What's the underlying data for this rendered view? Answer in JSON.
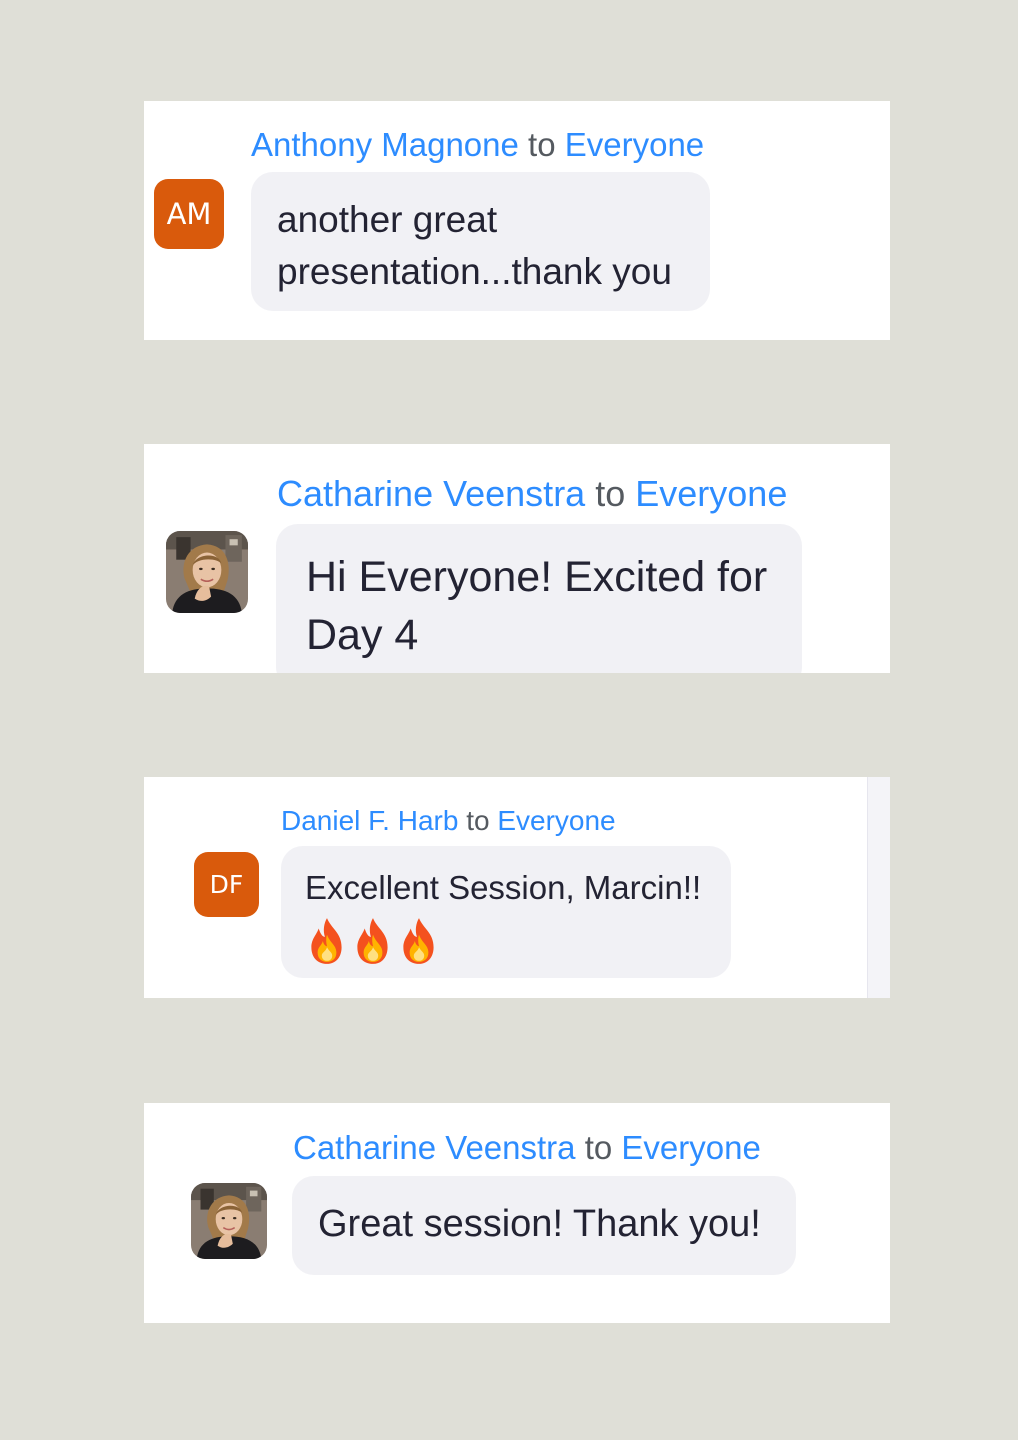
{
  "messages": [
    {
      "sender": "Anthony Magnone",
      "to_word": "to",
      "recipient": "Everyone",
      "avatar_initials": "AM",
      "text_lines": [
        "another great",
        "presentation...thank you"
      ]
    },
    {
      "sender": "Catharine Veenstra",
      "to_word": "to",
      "recipient": "Everyone",
      "avatar_icon": "user-photo-icon",
      "text_lines": [
        "Hi Everyone! Excited for",
        "Day 4"
      ]
    },
    {
      "sender": "Daniel F. Harb",
      "to_word": "to",
      "recipient": "Everyone",
      "avatar_initials": "DF",
      "text_lines": [
        "Excellent Session, Marcin!!"
      ],
      "emoji": [
        "fire-icon",
        "fire-icon",
        "fire-icon"
      ]
    },
    {
      "sender": "Catharine Veenstra",
      "to_word": "to",
      "recipient": "Everyone",
      "avatar_icon": "user-photo-icon",
      "text_lines": [
        "Great session! Thank you!"
      ]
    }
  ],
  "colors": {
    "page_background": "#dfdfd7",
    "card_background": "#ffffff",
    "name_blue": "#2d8cff",
    "bubble": "#f1f1f5",
    "avatar_orange": "#d95a0c",
    "message_text": "#232333"
  }
}
